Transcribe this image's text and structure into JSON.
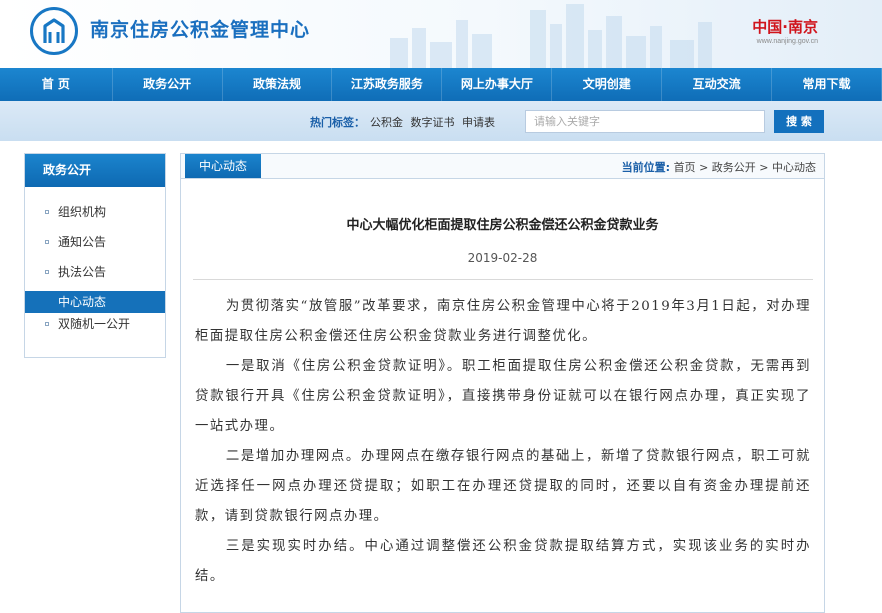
{
  "header": {
    "site_title": "南京住房公积金管理中心",
    "city_brand": "中国·南京",
    "city_url": "www.nanjing.gov.cn",
    "brand_color": "#1877c4",
    "city_color": "#d0141c"
  },
  "nav": {
    "items": [
      "首 页",
      "政务公开",
      "政策法规",
      "江苏政务服务",
      "网上办事大厅",
      "文明创建",
      "互动交流",
      "常用下载"
    ]
  },
  "search": {
    "hot_label": "热门标签：",
    "hot_tags": [
      "公积金",
      "数字证书",
      "申请表"
    ],
    "placeholder": "请输入关键字",
    "button_label": "搜 索"
  },
  "sidebar": {
    "heading": "政务公开",
    "items": [
      {
        "label": "组织机构",
        "active": false
      },
      {
        "label": "通知公告",
        "active": false
      },
      {
        "label": "执法公告",
        "active": false
      },
      {
        "label": "中心动态",
        "active": true
      },
      {
        "label": "双随机一公开",
        "active": false
      }
    ]
  },
  "main": {
    "section_tab": "中心动态",
    "breadcrumb": {
      "label": "当前位置:",
      "items": [
        "首页",
        "政务公开",
        "中心动态"
      ],
      "separator": ">"
    },
    "article": {
      "title": "中心大幅优化柜面提取住房公积金偿还公积金贷款业务",
      "date": "2019-02-28",
      "paragraphs": [
        "为贯彻落实“放管服”改革要求，南京住房公积金管理中心将于2019年3月1日起，对办理柜面提取住房公积金偿还住房公积金贷款业务进行调整优化。",
        "一是取消《住房公积金贷款证明》。职工柜面提取住房公积金偿还公积金贷款，无需再到贷款银行开具《住房公积金贷款证明》，直接携带身份证就可以在银行网点办理，真正实现了一站式办理。",
        "二是增加办理网点。办理网点在缴存银行网点的基础上，新增了贷款银行网点，职工可就近选择任一网点办理还贷提取；如职工在办理还贷提取的同时，还要以自有资金办理提前还款，请到贷款银行网点办理。",
        "三是实现实时办结。中心通过调整偿还公积金贷款提取结算方式，实现该业务的实时办结。"
      ]
    }
  }
}
